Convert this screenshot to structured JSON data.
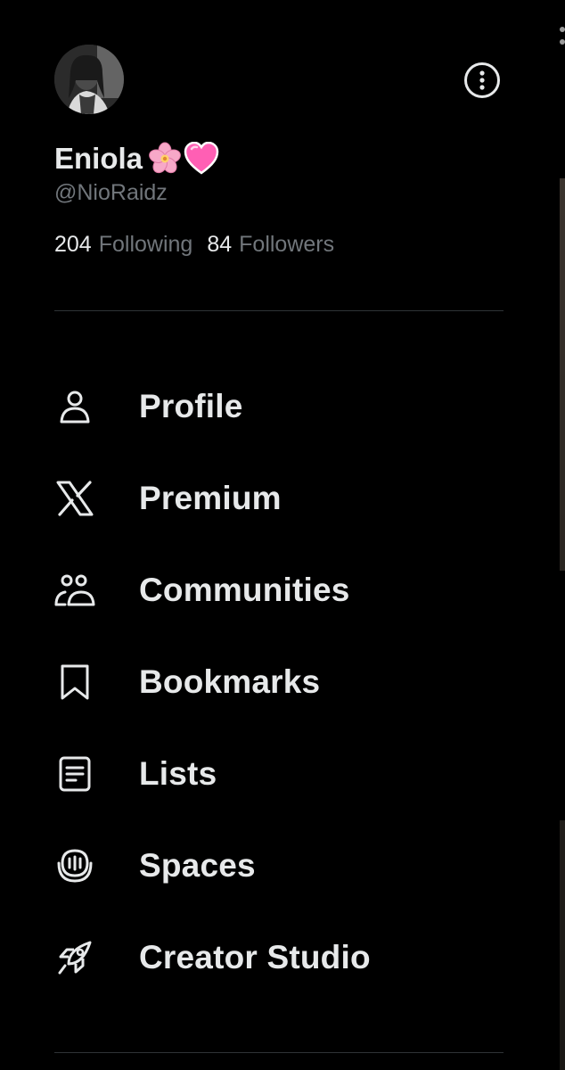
{
  "profile": {
    "display_name": "Eniola",
    "emoji_1": "🌸",
    "emoji_2": "💗",
    "handle": "@NioRaidz",
    "following_count": "204",
    "following_label": "Following",
    "followers_count": "84",
    "followers_label": "Followers"
  },
  "menu": {
    "items": [
      {
        "label": "Profile",
        "icon": "person-icon"
      },
      {
        "label": "Premium",
        "icon": "x-logo-icon"
      },
      {
        "label": "Communities",
        "icon": "communities-icon"
      },
      {
        "label": "Bookmarks",
        "icon": "bookmark-icon"
      },
      {
        "label": "Lists",
        "icon": "list-document-icon"
      },
      {
        "label": "Spaces",
        "icon": "spaces-microphone-icon"
      },
      {
        "label": "Creator Studio",
        "icon": "rocket-icon"
      }
    ]
  },
  "colors": {
    "background": "#000000",
    "text_primary": "#e7e9ea",
    "text_secondary": "#71767b",
    "divider": "#2f3336"
  }
}
